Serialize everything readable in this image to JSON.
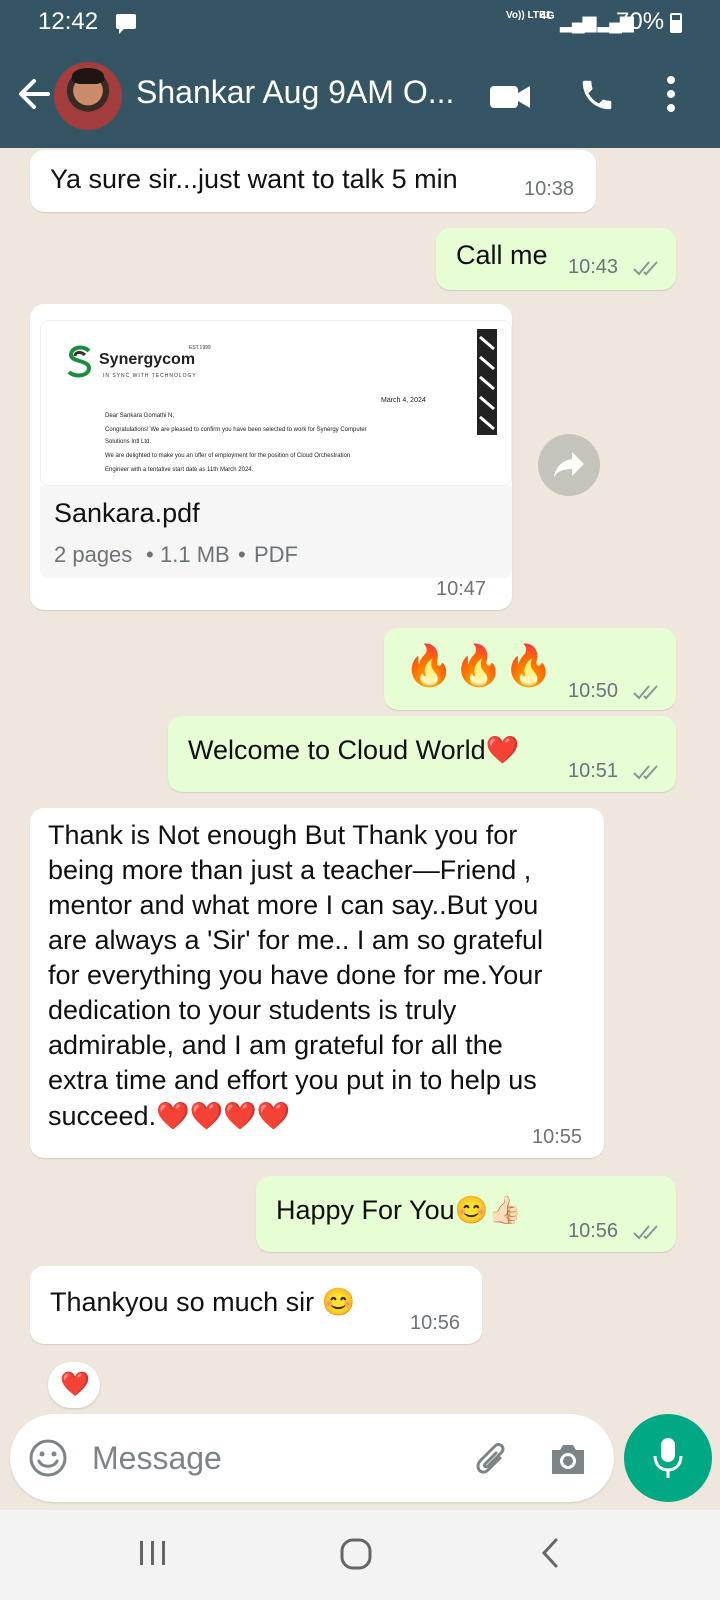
{
  "status_bar": {
    "time": "12:42",
    "network_label": "Vo)) LTE1",
    "network_type": "4G",
    "battery": "70%"
  },
  "header": {
    "contact_name": "Shankar Aug 9AM O..."
  },
  "messages": [
    {
      "dir": "in",
      "text": "Ya sure sir...just want to talk  5 min",
      "time": "10:38"
    },
    {
      "dir": "out",
      "text": "Call me",
      "time": "10:43",
      "status": "read"
    },
    {
      "dir": "in",
      "type": "document",
      "file_name": "Sankara.pdf",
      "pages": "2 pages",
      "size": "1.1 MB",
      "file_type": "PDF",
      "time": "10:47",
      "preview": {
        "company": "Synergycom",
        "established": "EST.1999",
        "tagline": "IN SYNC WITH TECHNOLOGY",
        "date": "March 4, 2024",
        "lines": [
          "Dear Sankara Gomathi N,",
          "Congratulations! We are pleased to confirm you have been selected to work for Synergy Computer",
          "Solutions Intl Ltd.",
          "We are delighted to make you an offer of employment for the position of Cloud Orchestration",
          "Engineer with a tentative start date as 11th March 2024."
        ]
      }
    },
    {
      "dir": "out",
      "text": "🔥🔥🔥",
      "time": "10:50",
      "status": "read"
    },
    {
      "dir": "out",
      "text": "Welcome to Cloud World❤️",
      "time": "10:51",
      "status": "read"
    },
    {
      "dir": "in",
      "lines": [
        "Thank is Not enough But Thank you for",
        "being more than just a teacher—Friend ,",
        "mentor and what more I can say..But you",
        "are always a 'Sir' for me.. I am so grateful",
        "for everything you have done for me.Your",
        "dedication to your students is truly",
        "admirable, and I am grateful for all the",
        "extra time and effort you put in to help us",
        "succeed.❤️❤️❤️❤️"
      ],
      "time": "10:55"
    },
    {
      "dir": "out",
      "text": "Happy For You😊👍🏻",
      "time": "10:56",
      "status": "read"
    },
    {
      "dir": "in",
      "text": "Thankyou so much sir 😊",
      "time": "10:56",
      "reaction": "❤️"
    }
  ],
  "composer": {
    "placeholder": "Message"
  },
  "icons": {
    "back": "arrow-left-icon",
    "video": "video-call-icon",
    "call": "phone-icon",
    "menu": "more-vert-icon",
    "forward": "forward-icon",
    "emoji": "emoji-icon",
    "attach": "paperclip-icon",
    "camera": "camera-icon",
    "mic": "mic-icon",
    "nav_recents": "recents-icon",
    "nav_home": "home-icon",
    "nav_back": "nav-back-icon"
  },
  "colors": {
    "header": "#355564",
    "outgoing_bubble": "#e7fdd4",
    "incoming_bubble": "#ffffff",
    "background": "#efe7dd",
    "read_ticks": "#8a9499",
    "mic_button": "#00a884"
  }
}
